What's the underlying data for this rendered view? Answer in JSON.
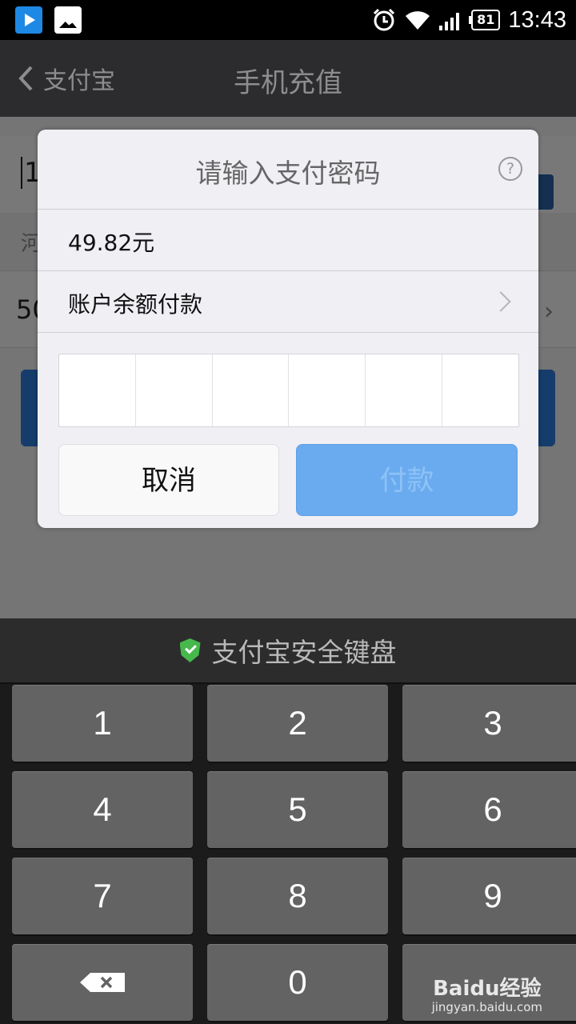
{
  "status_bar": {
    "time": "13:43",
    "battery": "81"
  },
  "nav": {
    "back_label": "支付宝",
    "title": "手机充值"
  },
  "page": {
    "phone_partial": "1",
    "location_partial": "河",
    "amount_partial": "50"
  },
  "dialog": {
    "title": "请输入支付密码",
    "amount": "49.82元",
    "payment_method": "账户余额付款",
    "password_cells": 6,
    "cancel_label": "取消",
    "pay_label": "付款"
  },
  "keyboard": {
    "title": "支付宝安全键盘",
    "keys": [
      "1",
      "2",
      "3",
      "4",
      "5",
      "6",
      "7",
      "8",
      "9",
      "",
      "0",
      ""
    ]
  },
  "watermark": {
    "brand": "Baidu经验",
    "url": "jingyan.baidu.com"
  },
  "colors": {
    "pay_button": "#6aabf0",
    "shield": "#46b84c",
    "navbar": "#2c2c2e"
  }
}
